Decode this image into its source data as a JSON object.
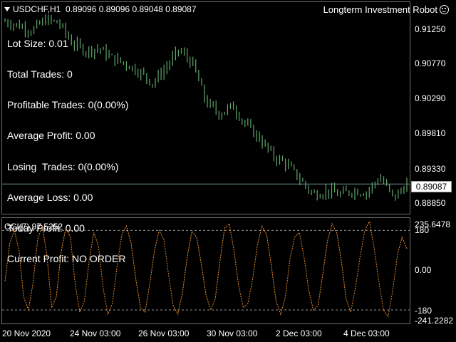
{
  "header": {
    "symbol": "USDCHF,H1",
    "ohlc": "0.89096 0.89096 0.89048 0.89087",
    "robot_title": "Longterm Investment Robot"
  },
  "stats": [
    "Lot Size: 0.01",
    "Total Trades: 0",
    "Profitable Trades: 0(0.00%)",
    "Average Profit: 0.00",
    "Losing  Trades: 0(0.00%)",
    "Average Loss: 0.00",
    "Today Profit: 0.00",
    "Current Profit: NO ORDER"
  ],
  "price_axis": [
    "0.91250",
    "0.90770",
    "0.90290",
    "0.89810",
    "0.89330",
    "0.88850"
  ],
  "current_price": "0.89087",
  "cci": {
    "label": "CCI(7) 97.5252",
    "axis": [
      "235.6478",
      "180",
      "0.00",
      "-180",
      "-241.2282"
    ]
  },
  "time_axis": [
    "20 Nov 2020",
    "24 Nov 03:00",
    "26 Nov 03:00",
    "30 Nov 03:00",
    "2 Dec 03:00",
    "4 Dec 03:00"
  ],
  "colors": {
    "candles": "#5fa86a",
    "cci": "#f0902a",
    "level": "#6f8f8f",
    "grid": "#c8c8c8"
  },
  "chart_data": [
    {
      "type": "line",
      "title": "USDCHF,H1",
      "ylim": [
        0.887,
        0.9145
      ],
      "x_index": [
        0,
        8,
        16,
        24,
        32,
        40,
        48,
        56,
        64,
        72,
        80,
        88,
        96,
        104,
        112,
        120,
        128,
        136,
        144,
        152,
        160,
        168,
        176,
        184,
        192,
        200,
        208,
        216,
        224,
        232,
        240
      ],
      "values": [
        0.912,
        0.9115,
        0.9108,
        0.9122,
        0.9118,
        0.9092,
        0.9082,
        0.9085,
        0.9072,
        0.9065,
        0.9055,
        0.904,
        0.906,
        0.9083,
        0.9065,
        0.9015,
        0.9,
        0.901,
        0.8985,
        0.8968,
        0.8945,
        0.8935,
        0.8915,
        0.8895,
        0.89,
        0.8895,
        0.89,
        0.8898,
        0.8918,
        0.889,
        0.8909
      ],
      "horizontal_line": 0.89087
    },
    {
      "type": "line",
      "title": "CCI(7) 97.5252",
      "ylim": [
        -241.2282,
        235.6478
      ],
      "levels": [
        180,
        -180
      ],
      "values": [
        -50,
        120,
        180,
        90,
        -120,
        -180,
        -60,
        140,
        200,
        60,
        -170,
        -120,
        80,
        190,
        150,
        -60,
        -190,
        -140,
        40,
        170,
        110,
        -80,
        -200,
        -150,
        20,
        160,
        200,
        120,
        -40,
        -170,
        -190,
        -60,
        90,
        180,
        140,
        -20,
        -160,
        -200,
        -100,
        60,
        175,
        150,
        30,
        -110,
        -180,
        -130,
        40,
        190,
        210,
        90,
        -70,
        -170,
        -150,
        -40,
        110,
        200,
        160,
        20,
        -140,
        -200,
        -120,
        50,
        150,
        170,
        60,
        -90,
        -180,
        -160,
        -20,
        130,
        210,
        170,
        40,
        -130,
        -190,
        -80,
        60,
        180,
        220,
        100,
        -50,
        -180,
        -210,
        -90,
        70,
        150,
        97.5
      ]
    }
  ]
}
